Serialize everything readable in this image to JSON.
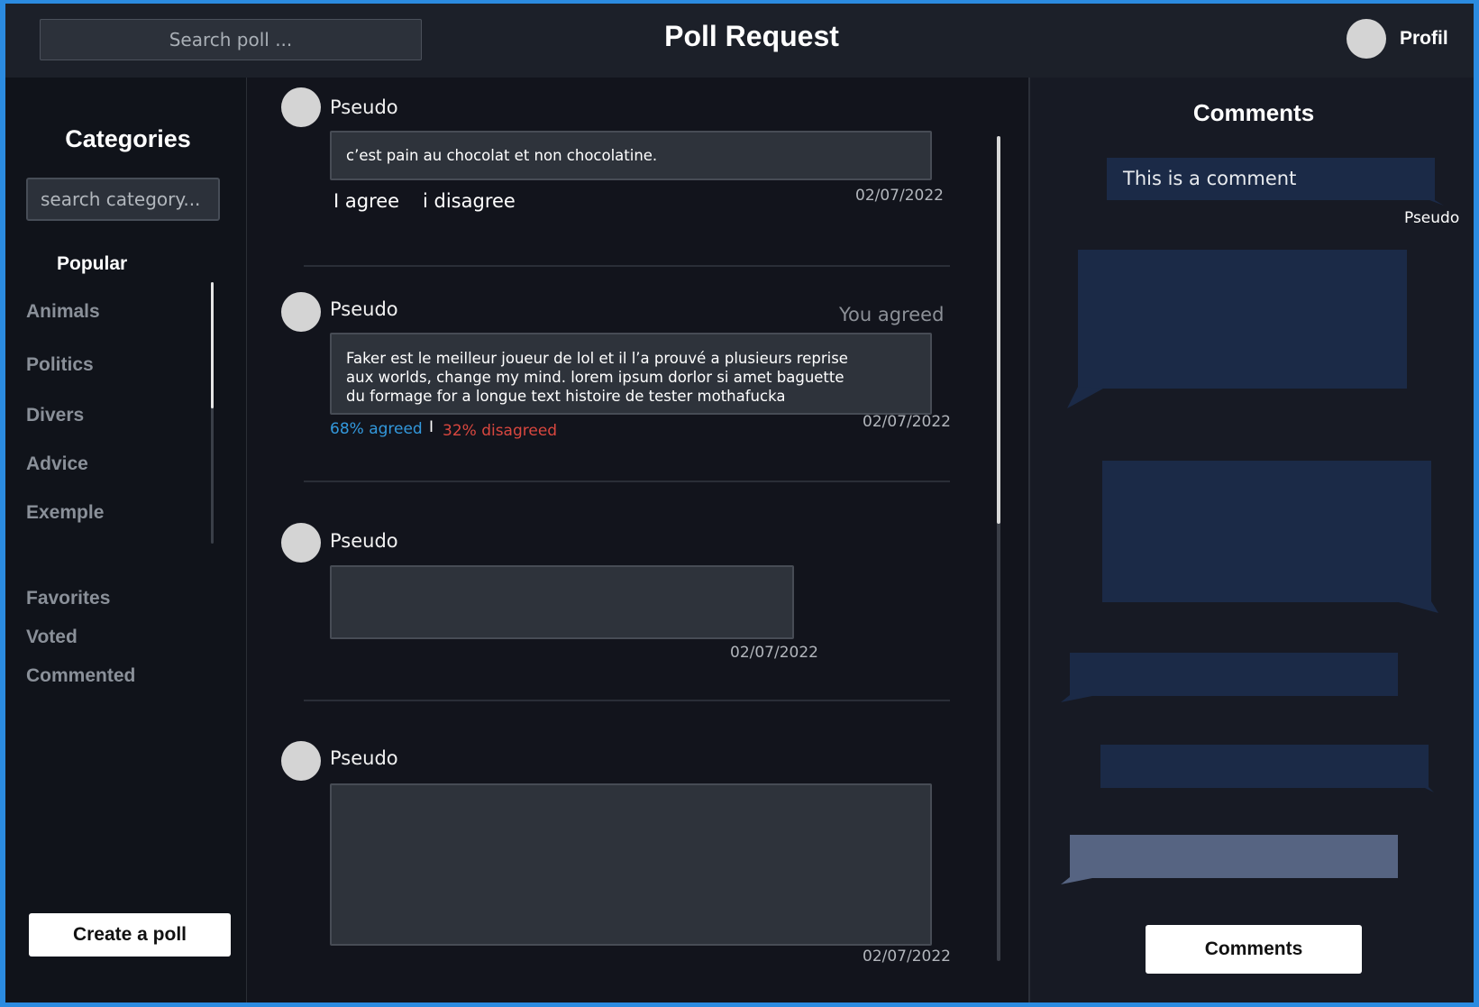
{
  "header": {
    "search_placeholder": "Search poll ...",
    "title": "Poll Request",
    "profile_label": "Profil"
  },
  "sidebar": {
    "title": "Categories",
    "search_placeholder": "search category...",
    "popular": "Popular",
    "categories": [
      "Animals",
      "Politics",
      "Divers",
      "Advice",
      "Exemple"
    ],
    "sections": [
      "Favorites",
      "Voted",
      "Commented"
    ],
    "create_button": "Create a poll"
  },
  "feed": {
    "polls": [
      {
        "author": "Pseudo",
        "text": "c’est pain au chocolat et non chocolatine.",
        "date": "02/07/2022",
        "agree_label": "I agree",
        "disagree_label": "i disagree"
      },
      {
        "author": "Pseudo",
        "status": "You agreed",
        "text_lines": [
          "Faker est le meilleur joueur de lol et il l’a prouvé a plusieurs reprise",
          "aux worlds, change my mind. lorem ipsum dorlor si amet baguette",
          "du formage for a longue text histoire de tester mothafucka"
        ],
        "date": "02/07/2022",
        "agreed_pct": "68% agreed",
        "separator": "I",
        "disagreed_pct": "32% disagreed"
      },
      {
        "author": "Pseudo",
        "text": "",
        "date": "02/07/2022"
      },
      {
        "author": "Pseudo",
        "text": "",
        "date": "02/07/2022"
      }
    ]
  },
  "comments": {
    "title": "Comments",
    "first_comment": "This is a comment",
    "first_comment_author": "Pseudo",
    "button": "Comments"
  },
  "colors": {
    "agreed": "#3399dd",
    "disagreed": "#d9473f",
    "bubble": "#1b2a47",
    "bubble_highlight": "#566482"
  }
}
